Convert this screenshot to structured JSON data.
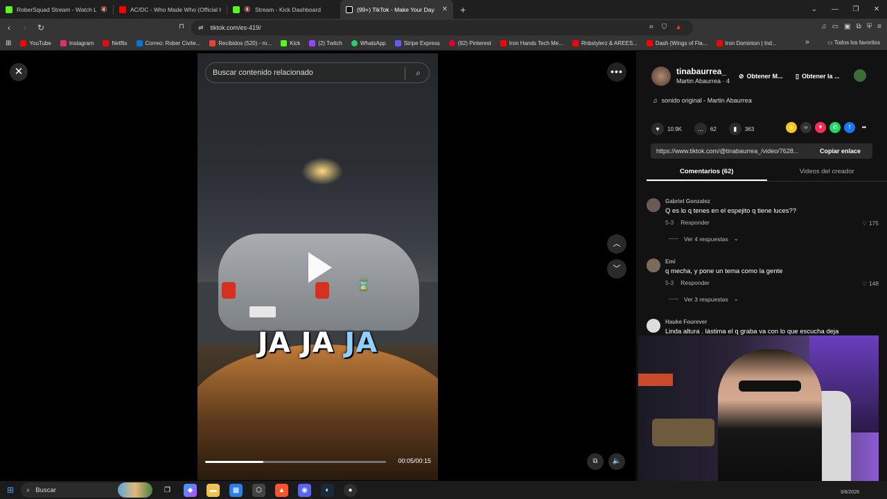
{
  "browser": {
    "tabs": [
      {
        "title": "RoberSquad Stream - Watch Live",
        "color": "#53fc18",
        "muted": true
      },
      {
        "title": "AC/DC - Who Made Who (Official HD",
        "color": "#ff0000",
        "muted": false
      },
      {
        "title": "Stream - Kick Dashboard",
        "color": "#53fc18",
        "muted": true
      },
      {
        "title": "(99+) TikTok - Make Your Day",
        "color": "#ffffff",
        "muted": false,
        "active": true
      }
    ],
    "new_tab": "+",
    "url": "tiktok.com/es-419/"
  },
  "bookmarks": {
    "items": [
      {
        "label": "YouTube",
        "color": "#ff0000"
      },
      {
        "label": "Instagram",
        "color": "#e1306c"
      },
      {
        "label": "Netflix",
        "color": "#e50914"
      },
      {
        "label": "Correo: Rober Civite...",
        "color": "#0078d4"
      },
      {
        "label": "Recibidos (520) - ro...",
        "color": "#ea4335"
      },
      {
        "label": "Kick",
        "color": "#53fc18"
      },
      {
        "label": "(2) Twitch",
        "color": "#9146ff"
      },
      {
        "label": "WhatsApp",
        "color": "#25d366"
      },
      {
        "label": "Stripe Express",
        "color": "#635bff"
      },
      {
        "label": "(92) Pinterest",
        "color": "#e60023"
      },
      {
        "label": "Iron Hands Tech Me...",
        "color": "#ff0000"
      },
      {
        "label": "Rnbstylerz & AREES...",
        "color": "#ff0000"
      },
      {
        "label": "Dash (Wings of Fla...",
        "color": "#ff0000"
      },
      {
        "label": "Iron Dominion | Ind...",
        "color": "#ff0000"
      }
    ],
    "all_label": "Todos los favoritos"
  },
  "player": {
    "search_placeholder": "Buscar contenido relacionado",
    "caption_white": "JA JA ",
    "caption_blue": "JA",
    "time": "00:05/00:15",
    "progress": 0.32
  },
  "panel": {
    "username": "tinabaurrea_",
    "nickname": "Martin Abaurrea · 4",
    "obtain_1": "Obtener M...",
    "obtain_2": "Obtener la ...",
    "sound": "sonido original - Martin Abaurrea",
    "likes": "10.9K",
    "comments": "62",
    "saves": "363",
    "link": "https://www.tiktok.com/@tinabaurrea_/video/7628...",
    "copy_label": "Copiar enlace",
    "tab_comments": "Comentarios (62)",
    "tab_videos": "Videos del creador",
    "comment_list": [
      {
        "name": "Gabriel Gonzalez",
        "text": "Q es lo q tenes en el espejito q tiene luces??",
        "date": "5-3",
        "reply": "Responder",
        "likes": "175",
        "more": "Ver 4 respuestas"
      },
      {
        "name": "Emi",
        "text": "q mecha, y pone un tema como la gente",
        "date": "5-3",
        "reply": "Responder",
        "likes": "148",
        "more": "Ver 3 respuestas"
      },
      {
        "name": "Hauke Fourever",
        "text": "Linda altura . lástima el q graba va con lo que escucha deja",
        "date": "",
        "reply": "",
        "likes": "",
        "more": ""
      }
    ]
  },
  "taskbar": {
    "search_label": "Buscar",
    "date": "3/6/2026"
  }
}
